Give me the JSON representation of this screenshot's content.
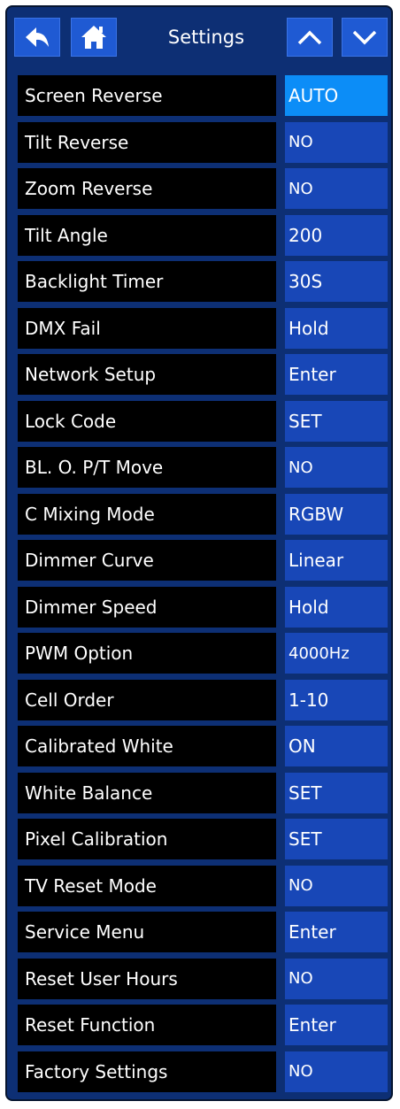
{
  "header": {
    "back_icon": "back-arrow-icon",
    "home_icon": "home-icon",
    "title": "Settings",
    "up_icon": "chevron-up-icon",
    "down_icon": "chevron-down-icon",
    "button_color": "#1f5ad3"
  },
  "colors": {
    "panel_bg": "#0d2f74",
    "label_bg": "#000000",
    "value_bg": "#1847b7",
    "active_value_bg": "#0c8df7"
  },
  "settings": [
    {
      "label": "Screen Reverse",
      "value": "AUTO",
      "selected": true
    },
    {
      "label": "Tilt Reverse",
      "value": "NO"
    },
    {
      "label": "Zoom Reverse",
      "value": "NO"
    },
    {
      "label": "Tilt Angle",
      "value": "200"
    },
    {
      "label": "Backlight Timer",
      "value": "30S"
    },
    {
      "label": "DMX Fail",
      "value": "Hold"
    },
    {
      "label": "Network Setup",
      "value": "Enter"
    },
    {
      "label": "Lock Code",
      "value": "SET"
    },
    {
      "label": "BL. O. P/T Move",
      "value": "NO"
    },
    {
      "label": "C Mixing Mode",
      "value": "RGBW"
    },
    {
      "label": "Dimmer Curve",
      "value": "Linear"
    },
    {
      "label": "Dimmer Speed",
      "value": "Hold"
    },
    {
      "label": "PWM Option",
      "value": "4000Hz"
    },
    {
      "label": "Cell Order",
      "value": "1-10"
    },
    {
      "label": "Calibrated White",
      "value": "ON"
    },
    {
      "label": "White Balance",
      "value": "SET"
    },
    {
      "label": "Pixel Calibration",
      "value": "SET"
    },
    {
      "label": "TV Reset Mode",
      "value": "NO"
    },
    {
      "label": "Service Menu",
      "value": "Enter"
    },
    {
      "label": "Reset User Hours",
      "value": "NO"
    },
    {
      "label": "Reset Function",
      "value": "Enter"
    },
    {
      "label": "Factory Settings",
      "value": "NO"
    }
  ]
}
